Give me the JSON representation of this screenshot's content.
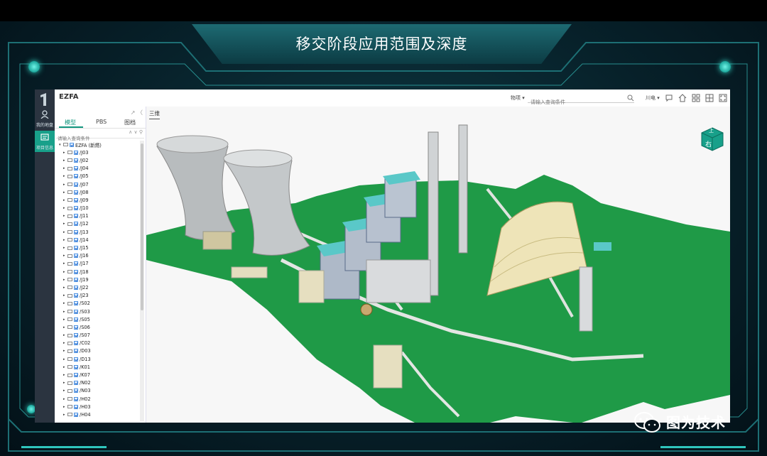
{
  "page_title": "移交阶段应用范围及深度",
  "watermark": "图为技术",
  "app": {
    "name": "EZFA",
    "rail": [
      {
        "label": "我的地盘",
        "icon": "user-icon"
      },
      {
        "label": "项目信息",
        "icon": "project-icon"
      }
    ],
    "topbar": {
      "search_category": "物项 ▾",
      "search_placeholder": "请输入查询条件",
      "user_menu": "川电 ▾"
    },
    "sidepanel": {
      "tools": "↗ 〈",
      "tabs": [
        "模型",
        "PBS",
        "图档"
      ],
      "search_placeholder": "请输入查询条件",
      "search_tools": "∧ ∨ ⚲",
      "tree_items": [
        "EZFA (新燃)",
        "/J03",
        "/J02",
        "/J04",
        "/J05",
        "/J07",
        "/J08",
        "/J09",
        "/J10",
        "/J11",
        "/J12",
        "/J13",
        "/J14",
        "/J15",
        "/J16",
        "/J17",
        "/J18",
        "/J19",
        "/J22",
        "/J23",
        "/S02",
        "/S03",
        "/S05",
        "/S06",
        "/S07",
        "/C02",
        "/D03",
        "/D13",
        "/K01",
        "/K07",
        "/N02",
        "/N03",
        "/H02",
        "/H03",
        "/H04"
      ]
    },
    "viewport": {
      "tab": "三维",
      "viewcube_top": "上",
      "viewcube_face": "右"
    }
  },
  "colors": {
    "accent": "#14977f",
    "ground": "#1f9a47",
    "building_roof": "#5ac8c8",
    "frame_line": "#2fa9a8"
  }
}
